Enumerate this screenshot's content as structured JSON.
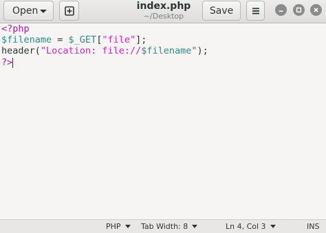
{
  "header": {
    "open_label": "Open",
    "title": "index.php",
    "subtitle": "~/Desktop",
    "save_label": "Save"
  },
  "editor": {
    "lines": [
      [
        "<?php"
      ],
      [
        "$filename",
        " = ",
        "$_GET",
        "[",
        "\"file\"",
        "];"
      ],
      [
        "header(",
        "\"Location: file://",
        "$filename",
        "\"",
        ");"
      ],
      [
        "?>"
      ]
    ]
  },
  "statusbar": {
    "language": "PHP",
    "tab_width": "Tab Width: 8",
    "position": "Ln 4, Col 3",
    "mode": "INS"
  },
  "colors": {
    "keyword": "#a31da3",
    "variable": "#2f8b84",
    "string": "#d421c2",
    "text": "#2e3436"
  },
  "icons": [
    "chevron-down-icon",
    "new-tab-icon",
    "hamburger-menu-icon",
    "minimize-icon",
    "maximize-icon",
    "close-icon"
  ]
}
